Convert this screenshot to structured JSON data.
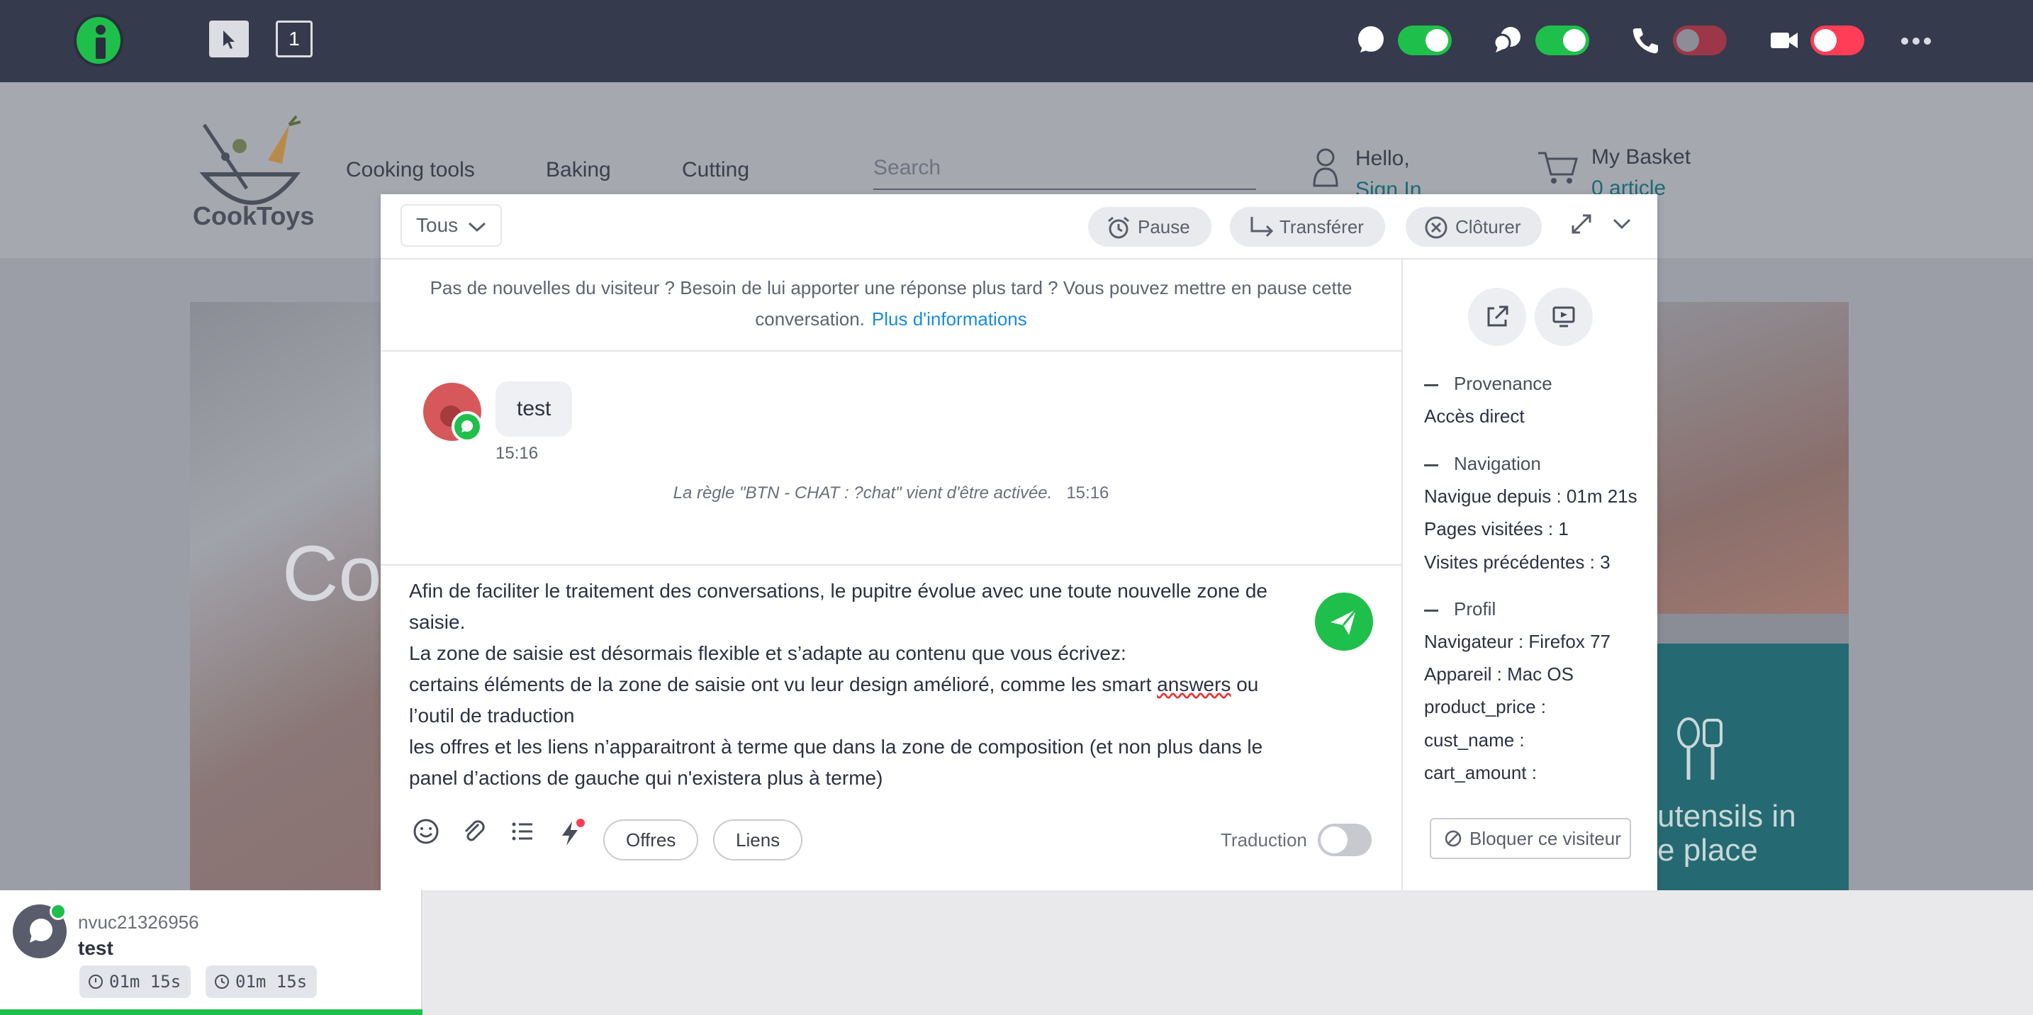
{
  "topbar": {
    "page_counter": "1",
    "toggles": {
      "chat": "on",
      "video_chat": "on",
      "phone": "off",
      "video": "off"
    }
  },
  "site": {
    "brand": "CookToys",
    "nav": [
      "Cooking tools",
      "Baking",
      "Cutting"
    ],
    "search_placeholder": "Search",
    "hello": "Hello,",
    "sign_in": "Sign In",
    "basket_title": "My Basket",
    "basket_count": "0 article",
    "hero_text": "Co",
    "promo_line1": "utensils in",
    "promo_line2": "e place"
  },
  "chat": {
    "filter": "Tous",
    "pause": "Pause",
    "transfer": "Transférer",
    "close": "Clôturer",
    "notice": "Pas de nouvelles du visiteur ? Besoin de lui apporter une réponse plus tard ? Vous pouvez mettre en pause cette conversation.",
    "notice_link": "Plus d'informations",
    "message": {
      "text": "test",
      "time": "15:16"
    },
    "rule": {
      "text": "La règle \"BTN - CHAT : ?chat\" vient d'être activée.",
      "time": "15:16"
    },
    "compose": {
      "line1": "Afin de faciliter le traitement des conversations, le pupitre évolue avec une toute nouvelle zone de saisie.",
      "line2": "La zone de saisie est désormais flexible et s’adapte au contenu que vous écrivez:",
      "line3a": "certains éléments de la zone de saisie ont vu leur design amélioré, comme les smart ",
      "line3b": "answers",
      "line3c": " ou l’outil de traduction",
      "line4": "les offres et les liens n’apparaitront à terme que dans la zone de composition (et non plus dans le panel d’actions de gauche qui n'existera plus à terme)"
    },
    "offers": "Offres",
    "links": "Liens",
    "translation": "Traduction",
    "translation_enabled": false
  },
  "sidebar": {
    "provenance_title": "Provenance",
    "provenance": "Accès direct",
    "navigation_title": "Navigation",
    "navigation": [
      "Navigue depuis : 01m 21s",
      "Pages visitées : 1",
      "Visites précédentes : 3"
    ],
    "profile_title": "Profil",
    "profile": [
      "Navigateur : Firefox 77",
      "Appareil : Mac OS",
      "product_price :",
      "cust_name :",
      "cart_amount :"
    ],
    "block": "Bloquer ce visiteur"
  },
  "dock": {
    "visitor_id": "nvuc21326956",
    "last_message": "test",
    "timer1": "01m 15s",
    "timer2": "01m 15s"
  },
  "colors": {
    "topbar": "#353a4d",
    "accent_green": "#1fbf4b",
    "toggle_off": "#ff3d57",
    "link": "#1a8ce0"
  }
}
